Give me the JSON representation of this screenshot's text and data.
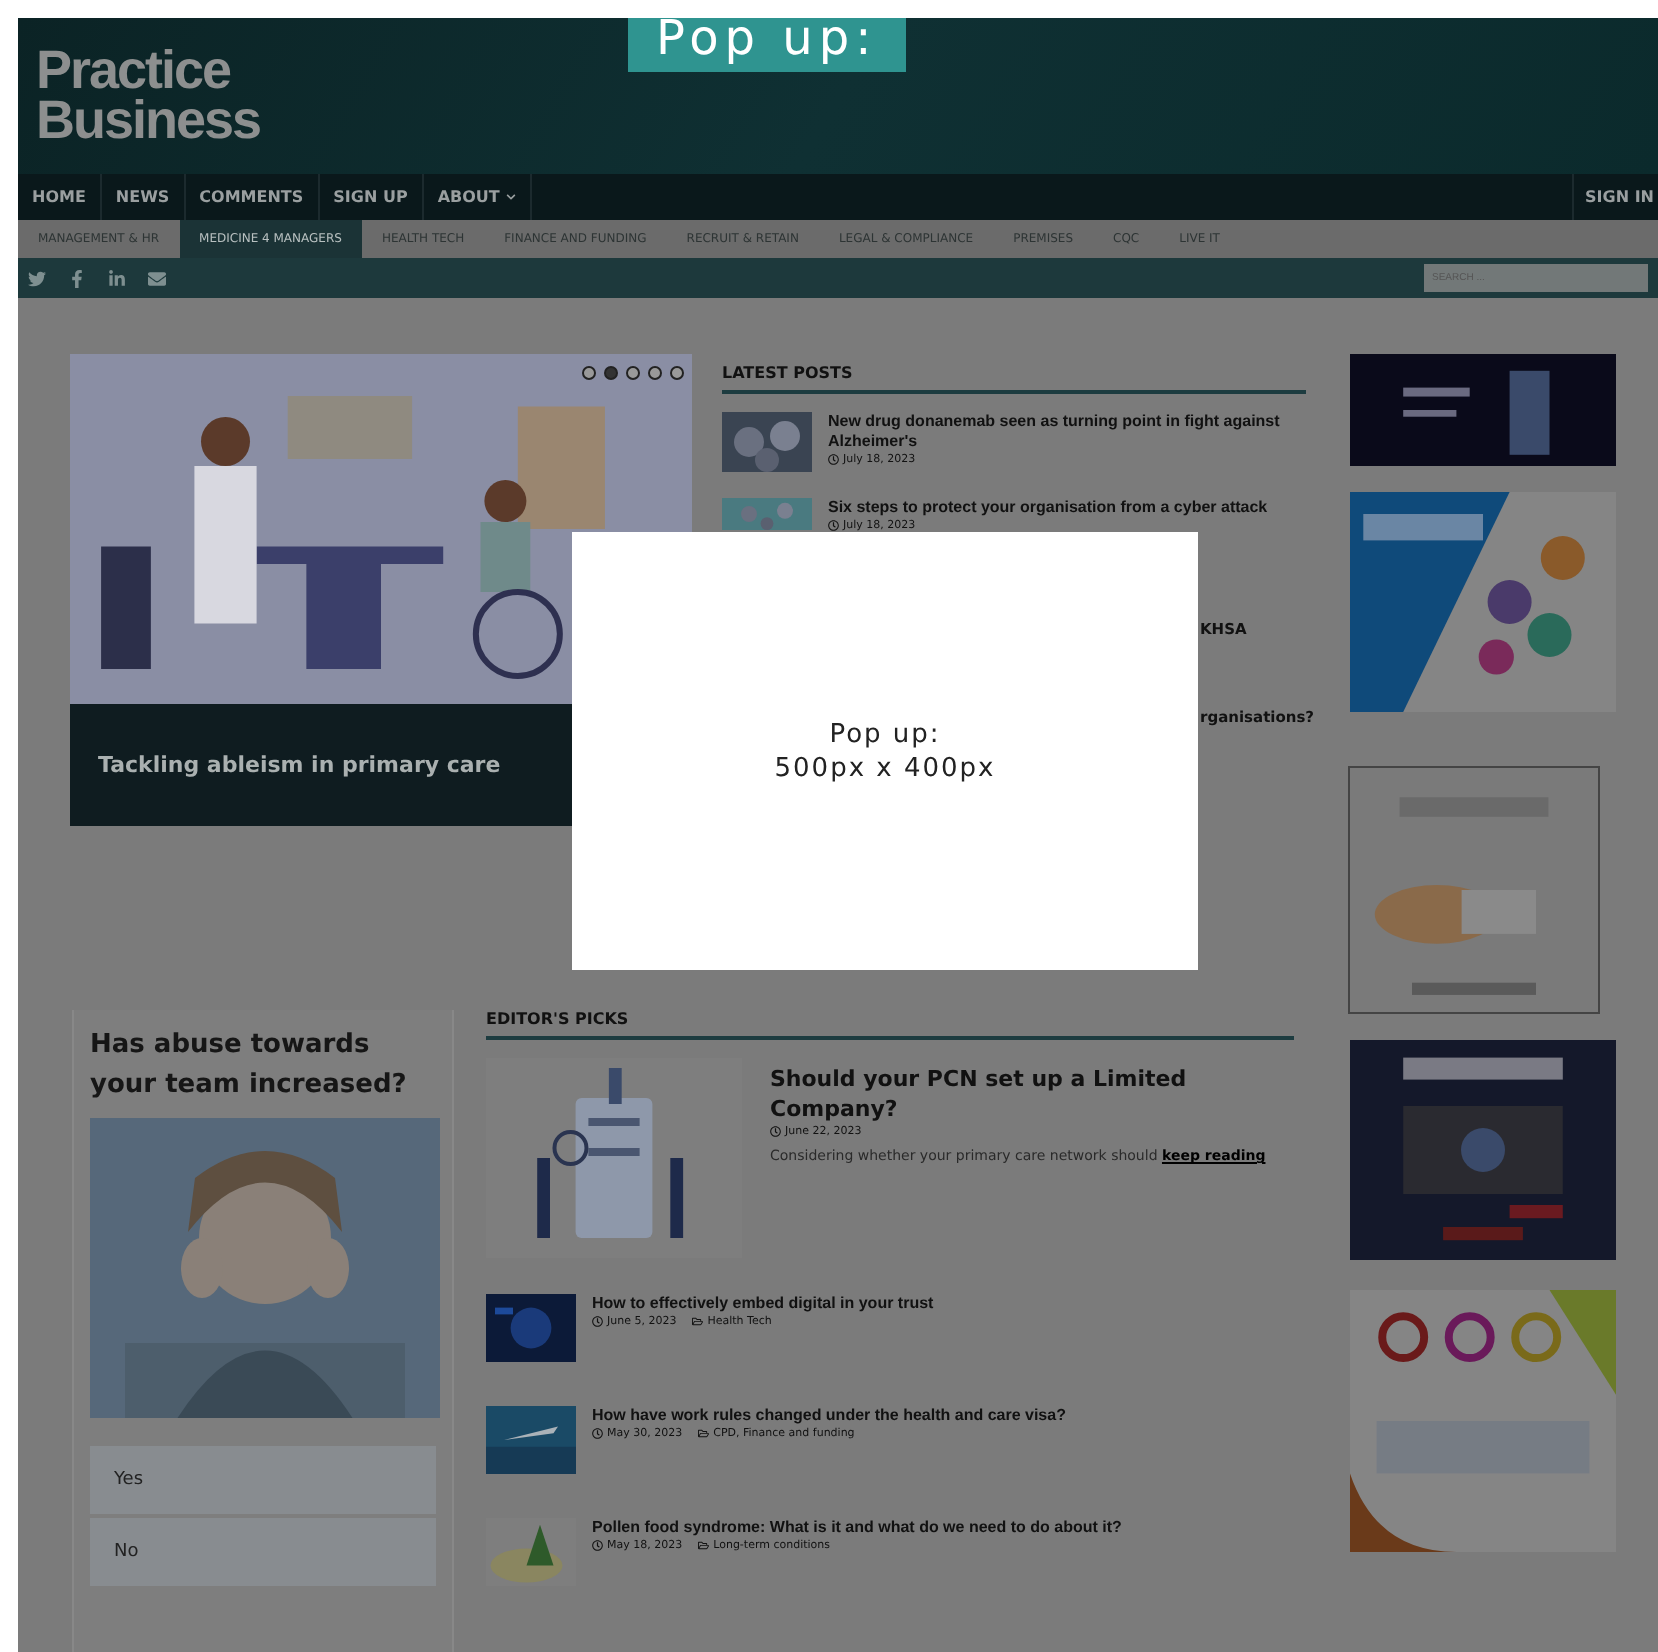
{
  "popup_label": "Pop up:",
  "header": {
    "logo": [
      "Practice",
      "Business"
    ]
  },
  "nav": {
    "items": [
      {
        "label": "HOME",
        "has_menu": false
      },
      {
        "label": "NEWS",
        "has_menu": false
      },
      {
        "label": "COMMENTS",
        "has_menu": false
      },
      {
        "label": "SIGN UP",
        "has_menu": false
      },
      {
        "label": "ABOUT",
        "has_menu": true
      }
    ],
    "sign_in": "SIGN IN"
  },
  "categories": [
    {
      "label": "MANAGEMENT & HR",
      "selected": false
    },
    {
      "label": "MEDICINE 4 MANAGERS",
      "selected": true
    },
    {
      "label": "HEALTH TECH",
      "selected": false
    },
    {
      "label": "FINANCE AND FUNDING",
      "selected": false
    },
    {
      "label": "RECRUIT & RETAIN",
      "selected": false
    },
    {
      "label": "LEGAL & COMPLIANCE",
      "selected": false
    },
    {
      "label": "PREMISES",
      "selected": false
    },
    {
      "label": "CQC",
      "selected": false
    },
    {
      "label": "LIVE IT",
      "selected": false
    }
  ],
  "search": {
    "placeholder": "SEARCH ..."
  },
  "slider": {
    "caption": "Tackling ableism in primary care",
    "dots": [
      {
        "selected": false
      },
      {
        "selected": true
      },
      {
        "selected": false
      },
      {
        "selected": false
      },
      {
        "selected": false
      }
    ]
  },
  "latest_posts": {
    "title": "LATEST POSTS",
    "items": [
      {
        "kind": "post",
        "title": "New drug donanemab seen as turning point in fight against Alzheimer's",
        "date": "July 18, 2023"
      },
      {
        "kind": "post",
        "title": "Six steps to protect your organisation from a cyber attack",
        "date": "July 18, 2023"
      },
      {
        "kind": "fragment",
        "title": "KHSA"
      },
      {
        "kind": "fragment",
        "title": "rganisations?"
      }
    ]
  },
  "popup": {
    "lines": [
      "Pop up:",
      "500px x 400px"
    ]
  },
  "poll": {
    "question": "Has abuse towards your team increased?",
    "options": [
      "Yes",
      "No"
    ]
  },
  "editors_picks": {
    "title": "EDITOR'S PICKS",
    "feature": {
      "title": "Should your PCN set up a Limited Company?",
      "date": "June 22, 2023",
      "excerpt": "Considering whether your primary care network should ",
      "link": "keep reading"
    },
    "items": [
      {
        "title": "How to effectively embed digital in your trust",
        "date": "June 5, 2023",
        "category": "Health Tech"
      },
      {
        "title": "How have work rules changed under the health and care visa?",
        "date": "May 30, 2023",
        "category": "CPD, Finance and funding"
      },
      {
        "title": "Pollen food syndrome: What is it and what do we need to do about it?",
        "date": "May 18, 2023",
        "category": "Long-term conditions"
      }
    ]
  }
}
